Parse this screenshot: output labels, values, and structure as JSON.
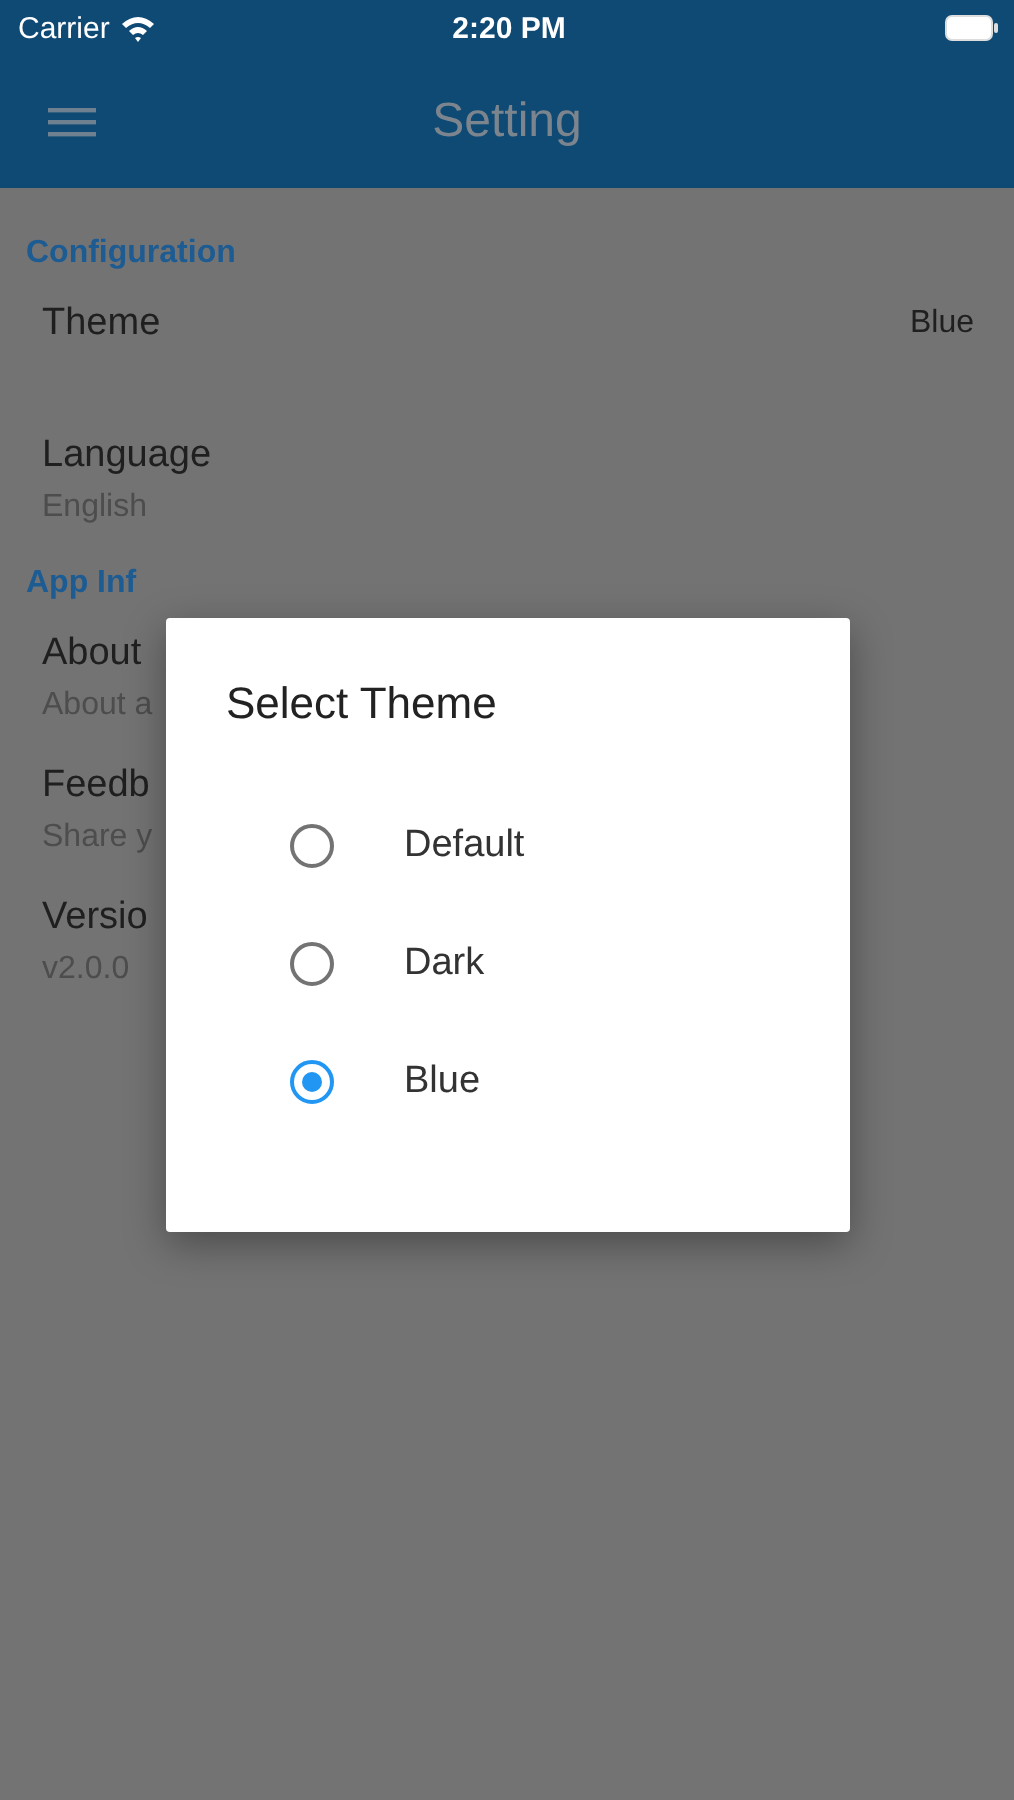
{
  "status_bar": {
    "carrier": "Carrier",
    "time": "2:20 PM"
  },
  "header": {
    "title": "Setting"
  },
  "sections": [
    {
      "title": "Configuration",
      "items": [
        {
          "title": "Theme",
          "value": "Blue"
        },
        {
          "title": "Language",
          "subtitle": "English"
        }
      ]
    },
    {
      "title": "App Inf",
      "items": [
        {
          "title": "About",
          "subtitle": "About a"
        },
        {
          "title": "Feedb",
          "subtitle": "Share y"
        },
        {
          "title": "Versio",
          "subtitle": "v2.0.0"
        }
      ]
    }
  ],
  "dialog": {
    "title": "Select Theme",
    "options": [
      {
        "label": "Default",
        "selected": false
      },
      {
        "label": "Dark",
        "selected": false
      },
      {
        "label": "Blue",
        "selected": true
      }
    ]
  }
}
